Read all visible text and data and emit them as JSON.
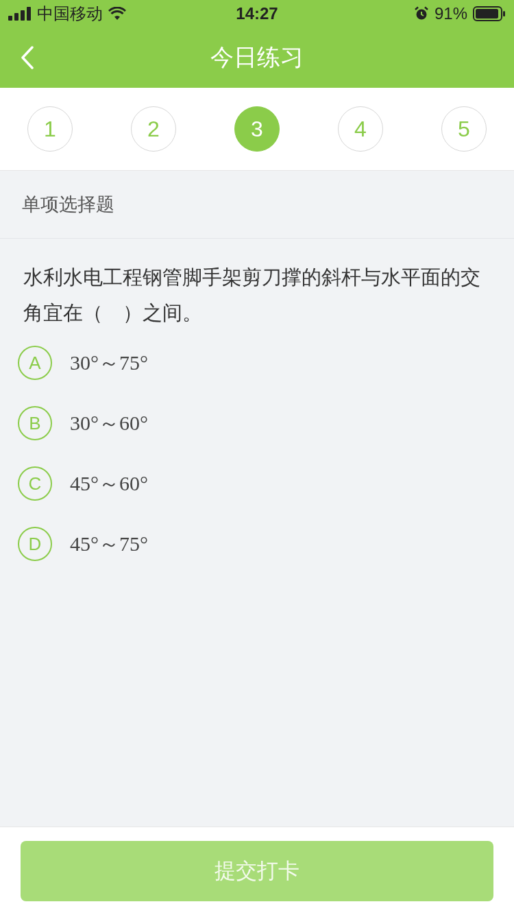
{
  "status_bar": {
    "carrier": "中国移动",
    "time": "14:27",
    "battery_percent": "91%"
  },
  "nav": {
    "title": "今日练习"
  },
  "steps": [
    {
      "label": "1",
      "selected": false
    },
    {
      "label": "2",
      "selected": false
    },
    {
      "label": "3",
      "selected": true
    },
    {
      "label": "4",
      "selected": false
    },
    {
      "label": "5",
      "selected": false
    }
  ],
  "question": {
    "type_label": "单项选择题",
    "text": "水利水电工程钢管脚手架剪刀撑的斜杆与水平面的交角宜在（　）之间。",
    "options": [
      {
        "letter": "A",
        "text": "30°～75°",
        "selected": false
      },
      {
        "letter": "B",
        "text": "30°～60°",
        "selected": false
      },
      {
        "letter": "C",
        "text": "45°～60°",
        "selected": false
      },
      {
        "letter": "D",
        "text": "45°～75°",
        "selected": false
      }
    ]
  },
  "submit_button": {
    "label": "提交打卡",
    "disabled": true
  }
}
